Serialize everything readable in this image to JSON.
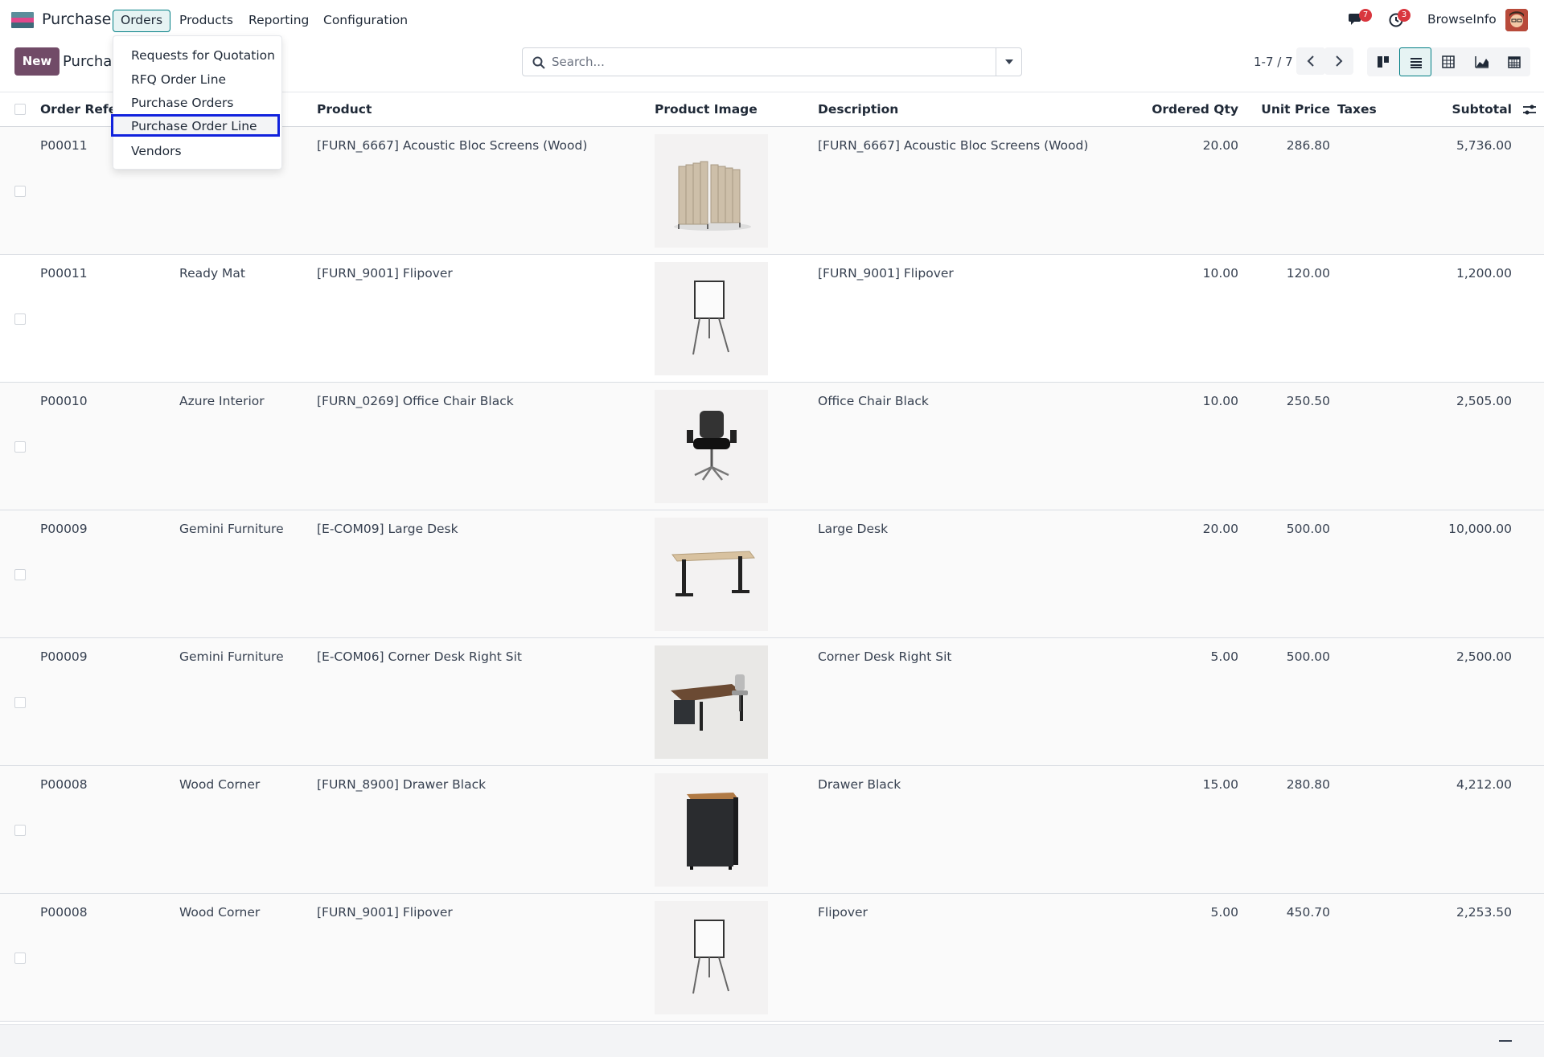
{
  "navbar": {
    "app_name": "Purchase",
    "menu": [
      {
        "label": "Orders",
        "active": true
      },
      {
        "label": "Products",
        "active": false
      },
      {
        "label": "Reporting",
        "active": false
      },
      {
        "label": "Configuration",
        "active": false
      }
    ],
    "messages_count": "7",
    "activities_count": "3",
    "company": "BrowseInfo"
  },
  "orders_menu": {
    "items": [
      "Requests for Quotation",
      "RFQ Order Line",
      "Purchase Orders",
      "Purchase Order Line",
      "Vendors"
    ],
    "highlighted": "Purchase Order Line"
  },
  "control_panel": {
    "new_label": "New",
    "breadcrumb": "Purchas",
    "search_placeholder": "Search...",
    "pager": "1-7 / 7",
    "active_view": "list"
  },
  "table": {
    "headers": {
      "order_ref": "Order Refere",
      "product": "Product",
      "image": "Product Image",
      "description": "Description",
      "qty": "Ordered Qty",
      "price": "Unit Price",
      "taxes": "Taxes",
      "subtotal": "Subtotal"
    },
    "rows": [
      {
        "ref": "P00011",
        "vendor": "",
        "product": "[FURN_6667] Acoustic Bloc Screens (Wood)",
        "image": "screens",
        "description": "[FURN_6667] Acoustic Bloc Screens (Wood)",
        "qty": "20.00",
        "price": "286.80",
        "taxes": "",
        "subtotal": "5,736.00"
      },
      {
        "ref": "P00011",
        "vendor": "Ready Mat",
        "product": "[FURN_9001] Flipover",
        "image": "flipover",
        "description": "[FURN_9001] Flipover",
        "qty": "10.00",
        "price": "120.00",
        "taxes": "",
        "subtotal": "1,200.00"
      },
      {
        "ref": "P00010",
        "vendor": "Azure Interior",
        "product": "[FURN_0269] Office Chair Black",
        "image": "chair",
        "description": "Office Chair Black",
        "qty": "10.00",
        "price": "250.50",
        "taxes": "",
        "subtotal": "2,505.00"
      },
      {
        "ref": "P00009",
        "vendor": "Gemini Furniture",
        "product": "[E-COM09] Large Desk",
        "image": "desk",
        "description": "Large Desk",
        "qty": "20.00",
        "price": "500.00",
        "taxes": "",
        "subtotal": "10,000.00"
      },
      {
        "ref": "P00009",
        "vendor": "Gemini Furniture",
        "product": "[E-COM06] Corner Desk Right Sit",
        "image": "corner-desk",
        "description": "Corner Desk Right Sit",
        "qty": "5.00",
        "price": "500.00",
        "taxes": "",
        "subtotal": "2,500.00"
      },
      {
        "ref": "P00008",
        "vendor": "Wood Corner",
        "product": "[FURN_8900] Drawer Black",
        "image": "drawer",
        "description": "Drawer Black",
        "qty": "15.00",
        "price": "280.80",
        "taxes": "",
        "subtotal": "4,212.00"
      },
      {
        "ref": "P00008",
        "vendor": "Wood Corner",
        "product": "[FURN_9001] Flipover",
        "image": "flipover",
        "description": "Flipover",
        "qty": "5.00",
        "price": "450.70",
        "taxes": "",
        "subtotal": "2,253.50"
      }
    ]
  },
  "colors": {
    "brand": "#714b67",
    "accent": "#017e84",
    "badge": "#d9363e",
    "highlight_border": "#1122dd"
  }
}
